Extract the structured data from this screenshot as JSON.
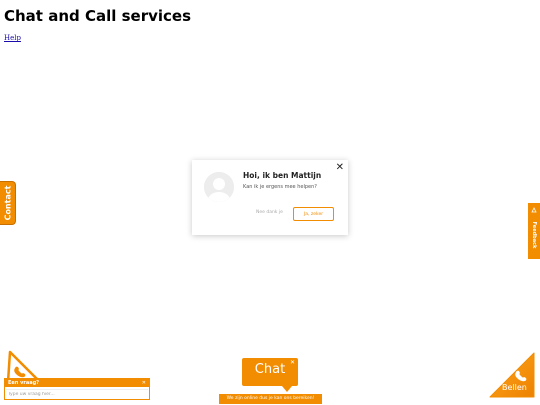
{
  "page": {
    "title": "Chat and Call services",
    "help_link": "Help"
  },
  "popup": {
    "name": "Hoi, ik ben Mattijn",
    "question": "Kan ik je ergens mee helpen?",
    "dismiss_label": "Nee dank je",
    "accept_label": "Ja, zeker",
    "close_symbol": "✕"
  },
  "contact_tab": {
    "label": "Contact"
  },
  "feedback_tab": {
    "label": "Feedback"
  },
  "ask_widget": {
    "title": "Een vraag?",
    "close_symbol": "✕",
    "placeholder": "Type uw vraag hier..."
  },
  "chat_bubble": {
    "label": "Chat",
    "close_symbol": "✕",
    "online_text": "We zijn online dus je kan ons bereiken!"
  },
  "call_button": {
    "label": "Bellen"
  },
  "colors": {
    "accent": "#f28c00",
    "accent_dark": "#c76f00",
    "popup_bg": "#ffffff",
    "link": "#1a0dab"
  },
  "icons": {
    "avatar": "user-silhouette-icon",
    "phone": "phone-icon",
    "feedback": "feedback-icon"
  }
}
